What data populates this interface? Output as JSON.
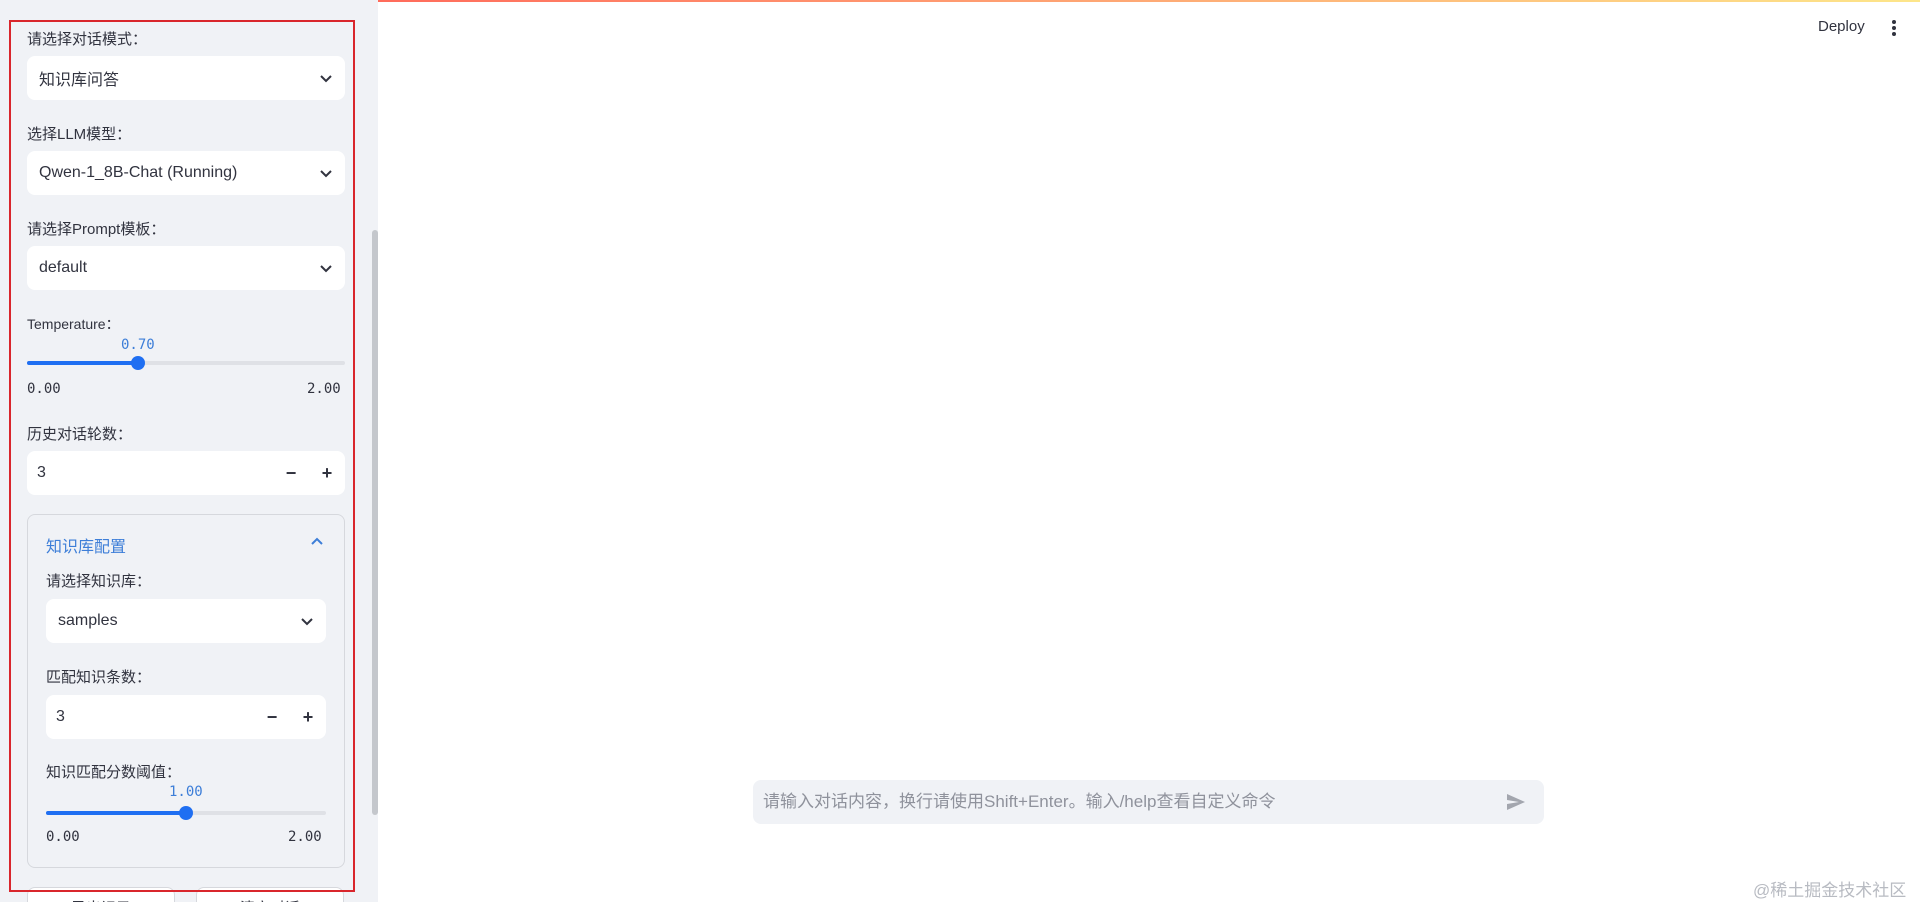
{
  "header": {
    "deploy_label": "Deploy",
    "menu_icon": "kebab-menu-icon"
  },
  "sidebar": {
    "dialog_mode": {
      "label": "请选择对话模式：",
      "value": "知识库问答"
    },
    "llm_model": {
      "label": "选择LLM模型：",
      "value": "Qwen-1_8B-Chat (Running)"
    },
    "prompt_template": {
      "label": "请选择Prompt模板：",
      "value": "default"
    },
    "temperature": {
      "label": "Temperature：",
      "value": 0.7,
      "value_text": "0.70",
      "min_text": "0.00",
      "max_text": "2.00",
      "min": 0,
      "max": 2
    },
    "history_rounds": {
      "label": "历史对话轮数：",
      "value": "3",
      "minus": "−",
      "plus": "+"
    },
    "kb_config": {
      "title": "知识库配置",
      "kb_select": {
        "label": "请选择知识库：",
        "value": "samples"
      },
      "match_count": {
        "label": "匹配知识条数：",
        "value": "3",
        "minus": "−",
        "plus": "+"
      },
      "score_threshold": {
        "label": "知识匹配分数阈值：",
        "value": 1.0,
        "value_text": "1.00",
        "min_text": "0.00",
        "max_text": "2.00",
        "min": 0,
        "max": 2
      }
    },
    "buttons": {
      "export": "导出记录",
      "clear": "清空对话"
    }
  },
  "chat": {
    "placeholder": "请输入对话内容，换行请使用Shift+Enter。输入/help查看自定义命令",
    "send_icon": "send-icon"
  },
  "watermark": "@稀土掘金技术社区",
  "colors": {
    "accent": "#1f6ff2",
    "expander_title": "#3d7ed8",
    "highlight_border": "#d9262c",
    "sidebar_bg": "#f0f2f6"
  }
}
